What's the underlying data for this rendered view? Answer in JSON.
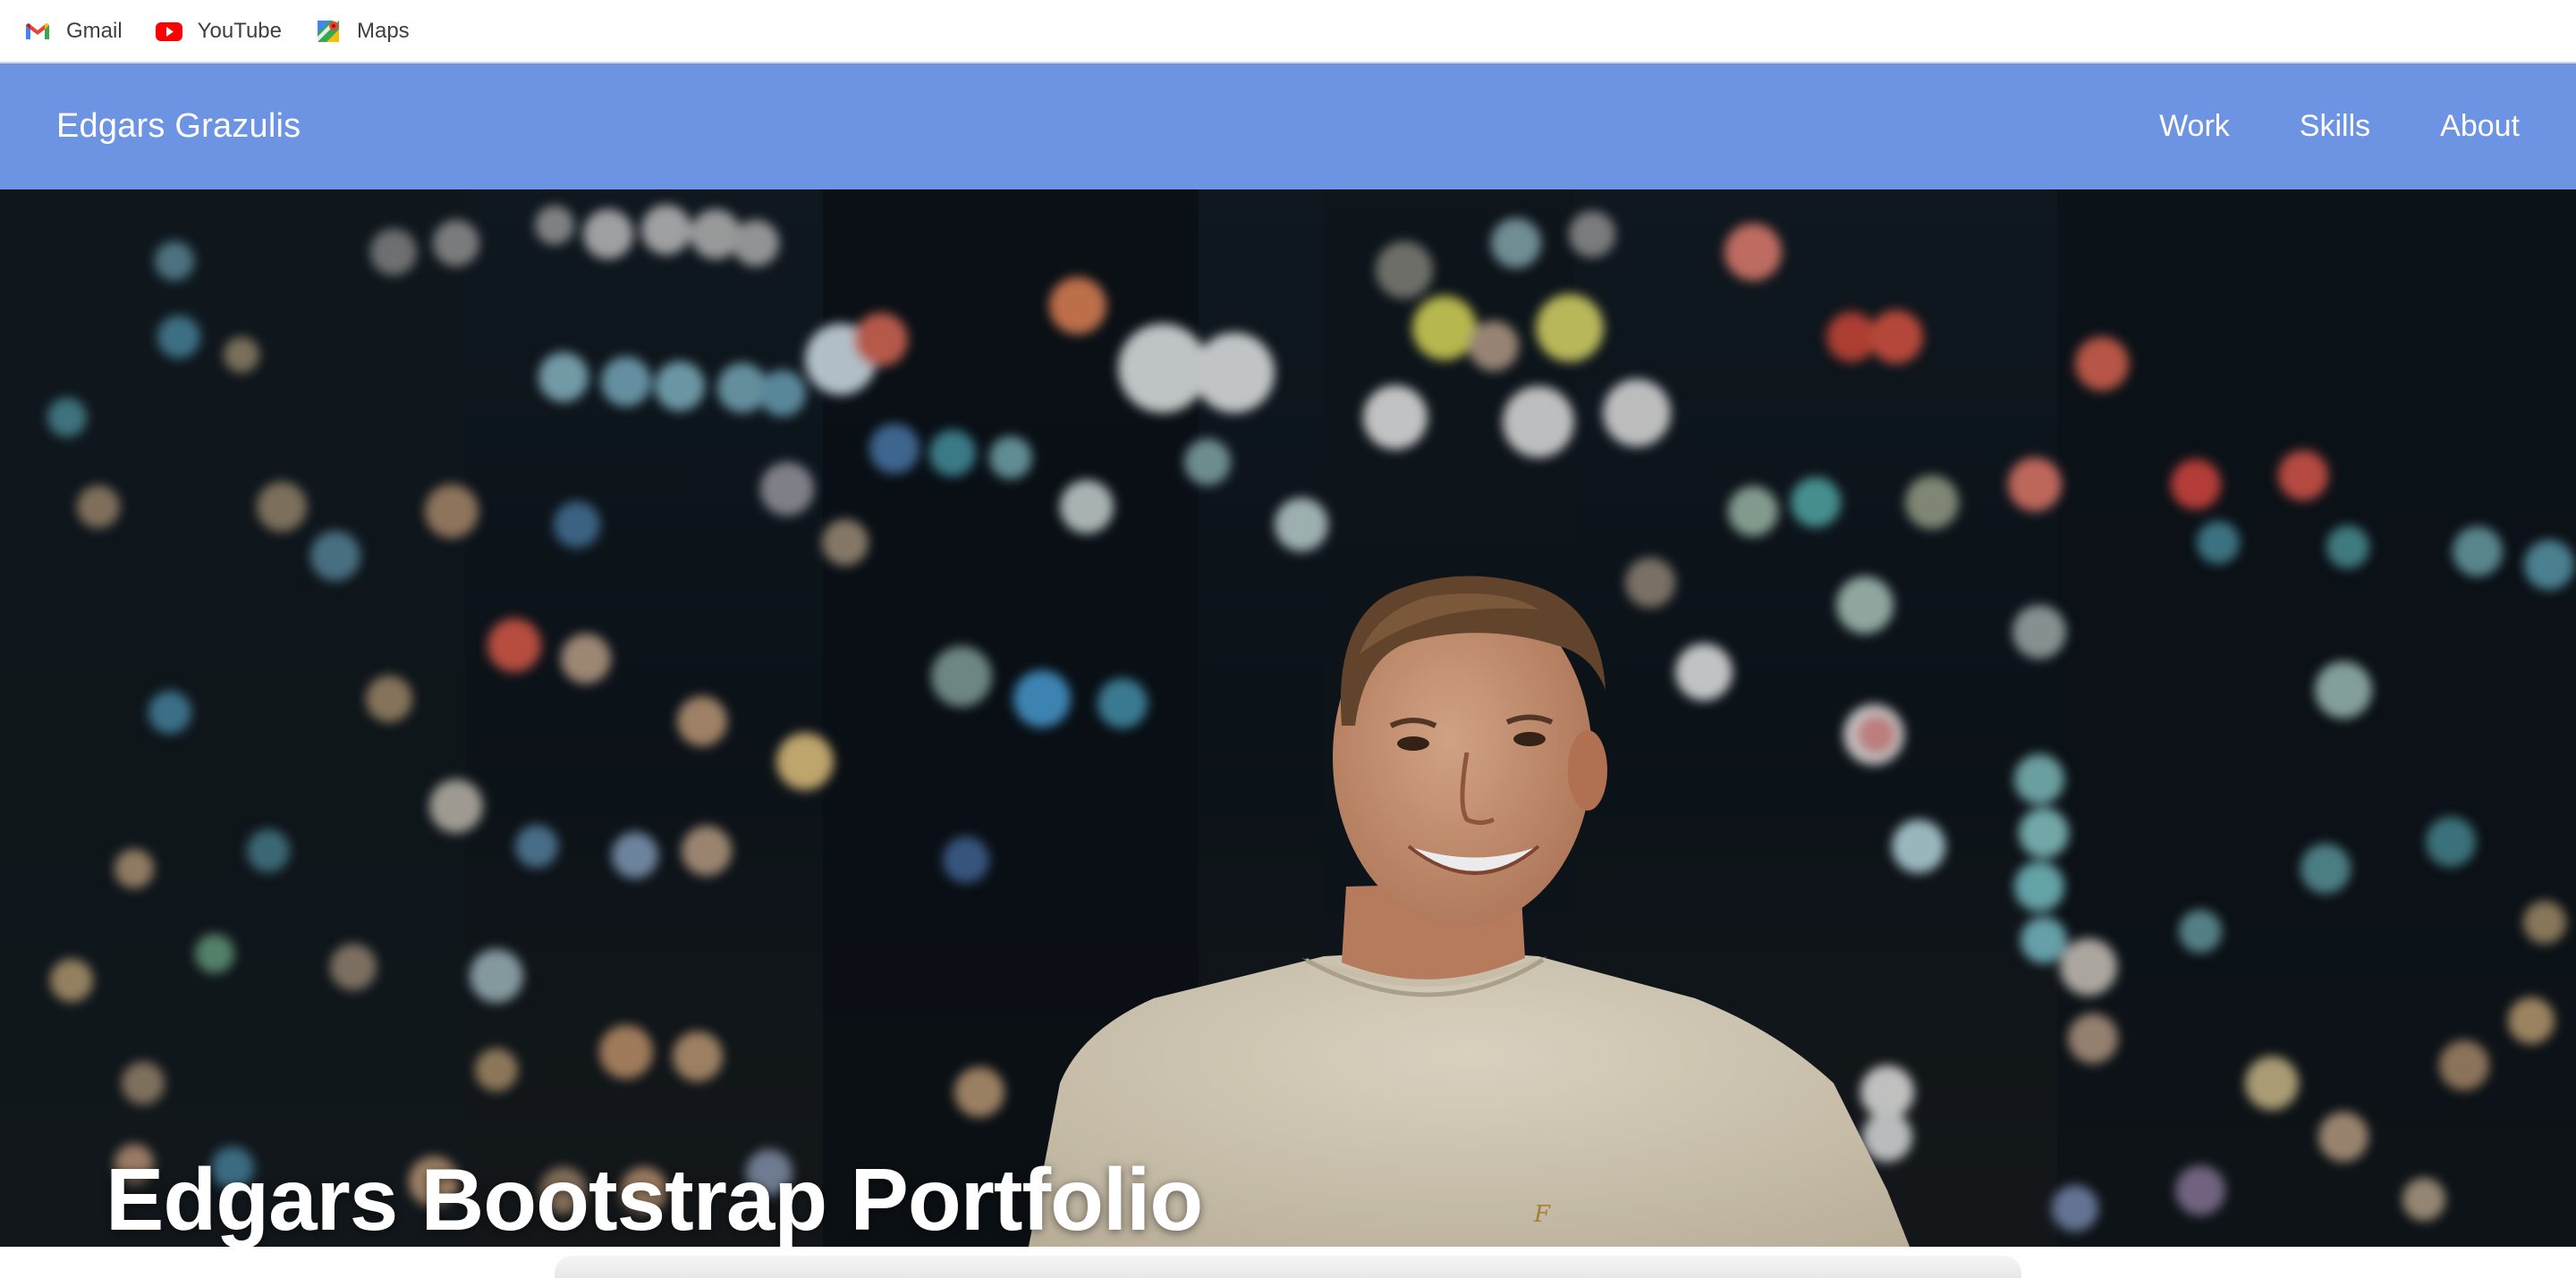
{
  "bookmarks": [
    {
      "label": "Gmail",
      "icon": "gmail-icon"
    },
    {
      "label": "YouTube",
      "icon": "youtube-icon"
    },
    {
      "label": "Maps",
      "icon": "maps-icon"
    }
  ],
  "navbar": {
    "brand": "Edgars Grazulis",
    "links": [
      "Work",
      "Skills",
      "About"
    ],
    "color": "#6d93e3"
  },
  "hero": {
    "title": "Edgars Bootstrap Portfolio",
    "image": "portrait-city-night-bokeh"
  }
}
